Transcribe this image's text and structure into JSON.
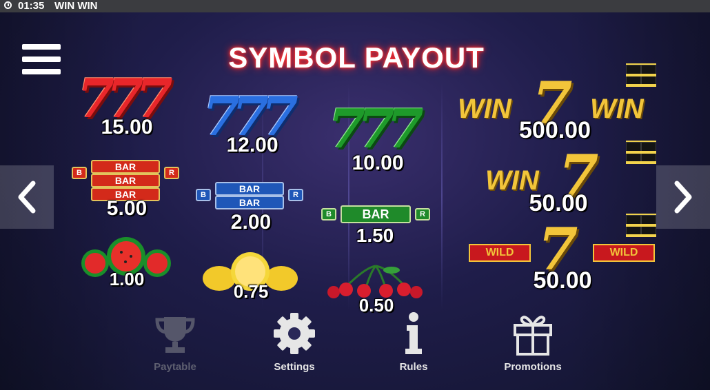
{
  "status_bar": {
    "time": "01:35",
    "app_title": "WIN WIN"
  },
  "header": {
    "title": "SYMBOL PAYOUT"
  },
  "symbols": [
    {
      "symbol": "red-seven",
      "payout": "15.00"
    },
    {
      "symbol": "blue-seven",
      "payout": "12.00"
    },
    {
      "symbol": "green-seven",
      "payout": "10.00"
    },
    {
      "symbol": "triple-bar",
      "payout": "5.00",
      "label": "BAR",
      "side_label": "B",
      "side_label_r": "R"
    },
    {
      "symbol": "double-bar",
      "payout": "2.00",
      "label": "BAR",
      "side_label": "B",
      "side_label_r": "R"
    },
    {
      "symbol": "single-bar",
      "payout": "1.50",
      "label": "BAR",
      "side_label": "B",
      "side_label_r": "R"
    },
    {
      "symbol": "watermelon",
      "payout": "1.00"
    },
    {
      "symbol": "lemon",
      "payout": "0.75"
    },
    {
      "symbol": "cherry",
      "payout": "0.50"
    }
  ],
  "special_symbols": [
    {
      "symbol": "win-7-win",
      "payout": "500.00",
      "word": "WIN"
    },
    {
      "symbol": "win-7",
      "payout": "50.00",
      "word": "WIN"
    },
    {
      "symbol": "wild-7",
      "payout": "50.00",
      "word": "WILD"
    }
  ],
  "bottom_nav": [
    {
      "label": "Paytable",
      "icon": "trophy-icon",
      "active": false
    },
    {
      "label": "Settings",
      "icon": "gear-icon",
      "active": true
    },
    {
      "label": "Rules",
      "icon": "info-icon",
      "active": true
    },
    {
      "label": "Promotions",
      "icon": "gift-icon",
      "active": true
    }
  ],
  "colors": {
    "accent_red": "#ff2a2a",
    "gold": "#f2c53a",
    "nav_active": "#e6e6e6",
    "nav_inactive": "#6a6a7a"
  }
}
